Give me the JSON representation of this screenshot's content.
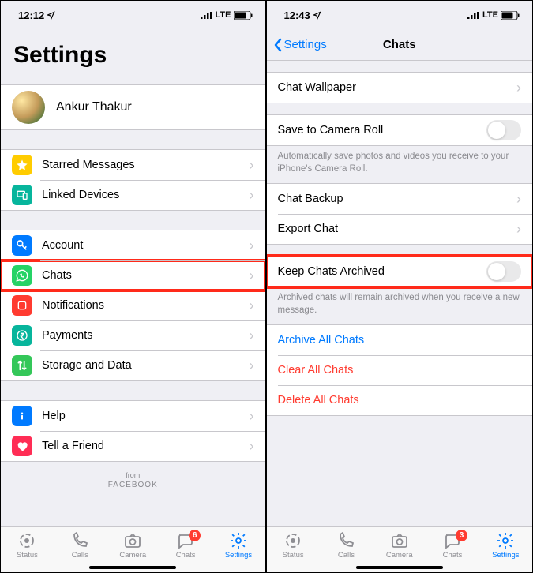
{
  "left": {
    "status": {
      "time": "12:12",
      "network": "LTE"
    },
    "title": "Settings",
    "profile": {
      "name": "Ankur Thakur"
    },
    "group1": [
      {
        "icon_name": "star-icon",
        "bg": "#ffcc00",
        "label": "Starred Messages"
      },
      {
        "icon_name": "devices-icon",
        "bg": "#07b59c",
        "label": "Linked Devices"
      }
    ],
    "group2": [
      {
        "icon_name": "key-icon",
        "bg": "#007aff",
        "label": "Account"
      },
      {
        "icon_name": "whatsapp-icon",
        "bg": "#25d366",
        "label": "Chats",
        "highlight": true
      },
      {
        "icon_name": "bell-icon",
        "bg": "#ff3b30",
        "label": "Notifications"
      },
      {
        "icon_name": "rupee-icon",
        "bg": "#07b59c",
        "label": "Payments"
      },
      {
        "icon_name": "arrows-icon",
        "bg": "#34c759",
        "label": "Storage and Data"
      }
    ],
    "group3": [
      {
        "icon_name": "info-icon",
        "bg": "#007aff",
        "label": "Help"
      },
      {
        "icon_name": "heart-icon",
        "bg": "#ff2d55",
        "label": "Tell a Friend"
      }
    ],
    "footer_from": "from",
    "footer_brand": "FACEBOOK",
    "tabs": [
      {
        "name": "status",
        "label": "Status"
      },
      {
        "name": "calls",
        "label": "Calls"
      },
      {
        "name": "camera",
        "label": "Camera"
      },
      {
        "name": "chats",
        "label": "Chats",
        "badge": "6"
      },
      {
        "name": "settings",
        "label": "Settings",
        "active": true
      }
    ]
  },
  "right": {
    "status": {
      "time": "12:43",
      "network": "LTE"
    },
    "back": "Settings",
    "title": "Chats",
    "rows": {
      "wallpaper": "Chat Wallpaper",
      "save_camera": "Save to Camera Roll",
      "save_caption": "Automatically save photos and videos you receive to your iPhone's Camera Roll.",
      "backup": "Chat Backup",
      "export": "Export Chat",
      "keep_archived": "Keep Chats Archived",
      "keep_caption": "Archived chats will remain archived when you receive a new message.",
      "archive_all": "Archive All Chats",
      "clear_all": "Clear All Chats",
      "delete_all": "Delete All Chats"
    },
    "tabs": [
      {
        "name": "status",
        "label": "Status"
      },
      {
        "name": "calls",
        "label": "Calls"
      },
      {
        "name": "camera",
        "label": "Camera"
      },
      {
        "name": "chats",
        "label": "Chats",
        "badge": "3"
      },
      {
        "name": "settings",
        "label": "Settings",
        "active": true
      }
    ]
  }
}
